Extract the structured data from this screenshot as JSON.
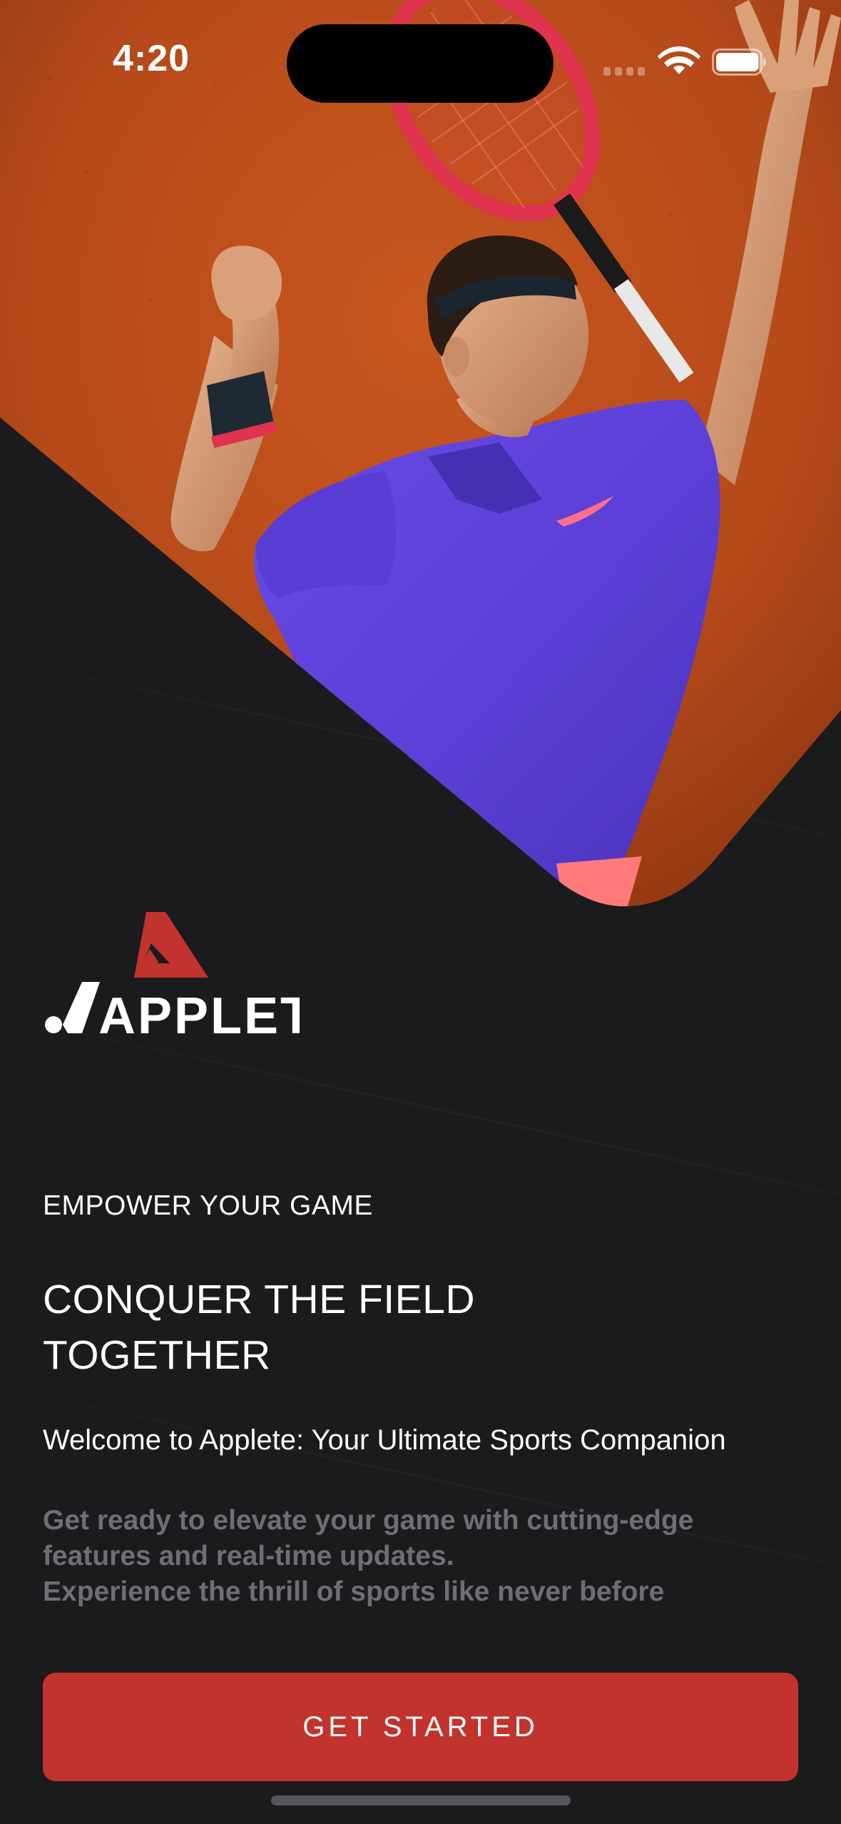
{
  "status_bar": {
    "time": "4:20"
  },
  "brand": {
    "name": "APPLETE",
    "accent_color": "#c1332c"
  },
  "hero": {
    "image": "tennis-player-serving-photo"
  },
  "content": {
    "kicker": "EMPOWER YOUR GAME",
    "headline_lines": [
      "CONQUER THE FIELD",
      "TOGETHER"
    ],
    "welcome": "Welcome to Applete: Your Ultimate Sports Companion",
    "description_lines": [
      "Get ready to elevate your game with cutting-edge",
      "features and real-time updates.",
      "Experience the thrill of sports like never before"
    ]
  },
  "cta": {
    "label": "GET STARTED"
  },
  "icons": {
    "wifi": "wifi-icon",
    "battery": "battery-icon",
    "logo_mark": "triangle-logo-icon"
  }
}
